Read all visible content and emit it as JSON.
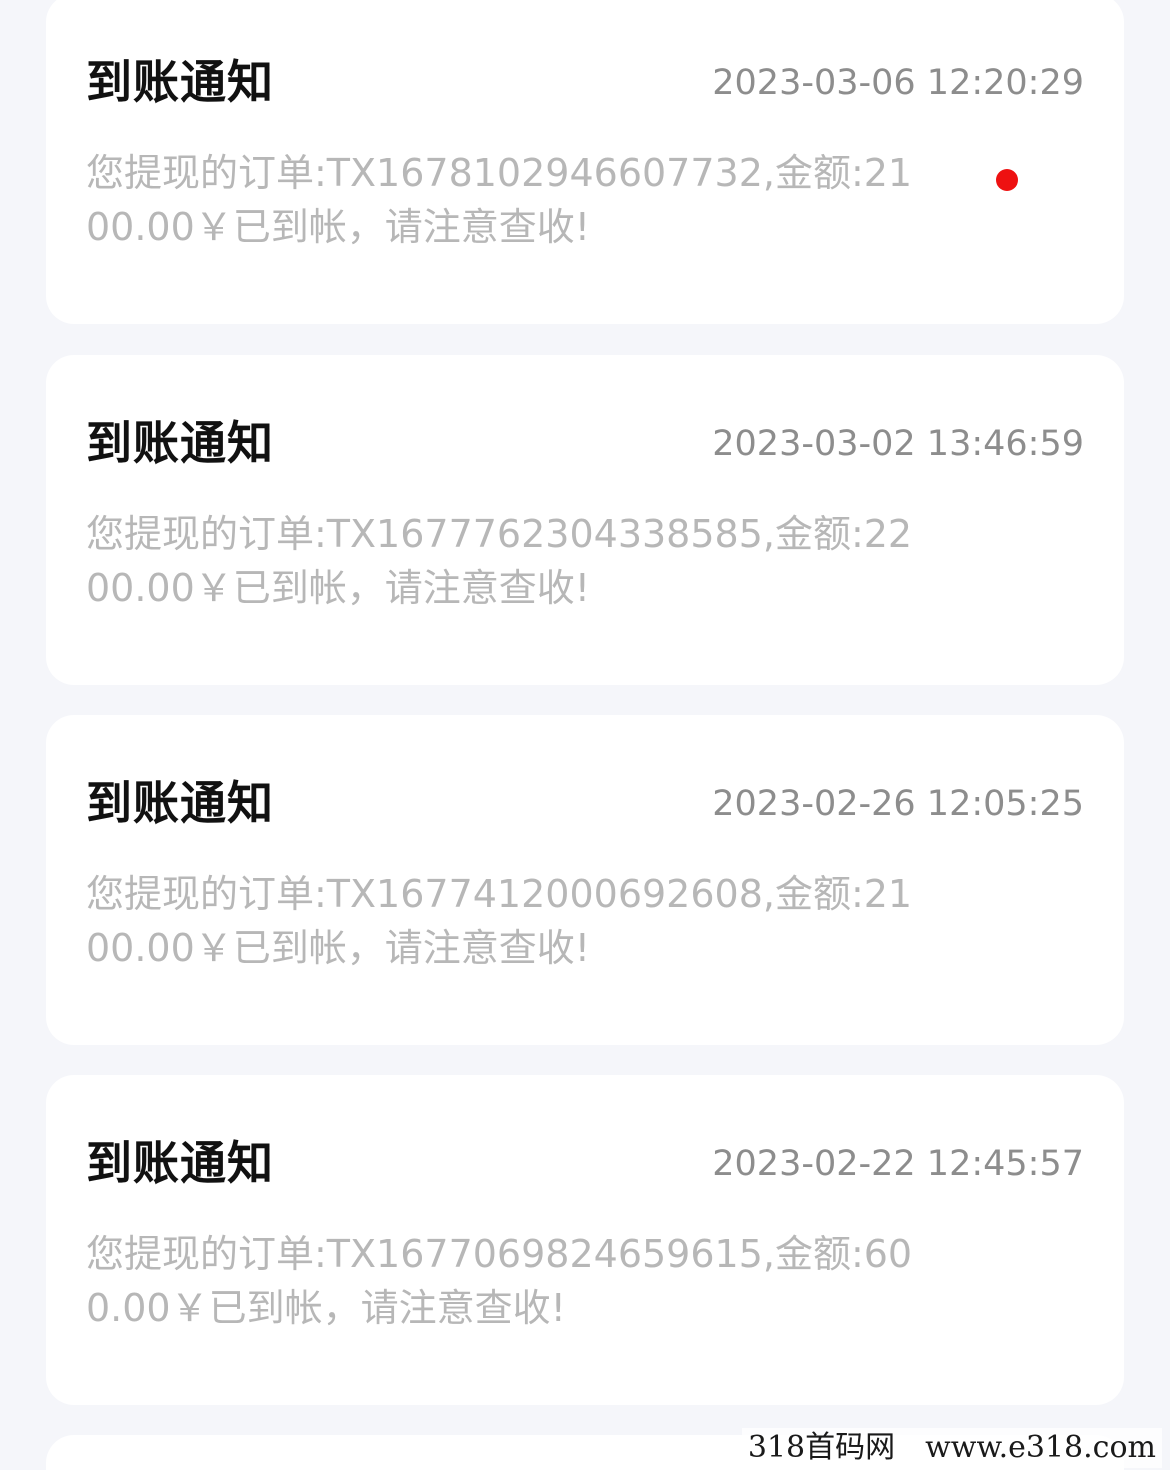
{
  "notifications": [
    {
      "title": "到账通知",
      "time": "2023-03-06 12:20:29",
      "message": "您提现的订单:TX1678102946607732,金额:2100.00￥已到帐，请注意查收!",
      "unread": true
    },
    {
      "title": "到账通知",
      "time": "2023-03-02 13:46:59",
      "message": "您提现的订单:TX1677762304338585,金额:2200.00￥已到帐，请注意查收!",
      "unread": false
    },
    {
      "title": "到账通知",
      "time": "2023-02-26 12:05:25",
      "message": "您提现的订单:TX1677412000692608,金额:2100.00￥已到帐，请注意查收!",
      "unread": false
    },
    {
      "title": "到账通知",
      "time": "2023-02-22 12:45:57",
      "message": "您提现的订单:TX1677069824659615,金额:600.00￥已到帐，请注意查收!",
      "unread": false
    }
  ],
  "watermark": "318首码网　www.e318.com",
  "colors": {
    "background": "#f5f6fa",
    "card": "#ffffff",
    "title": "#111111",
    "time": "#8d8d8d",
    "message": "#b7b7b7",
    "unread_dot": "#ee1111"
  }
}
